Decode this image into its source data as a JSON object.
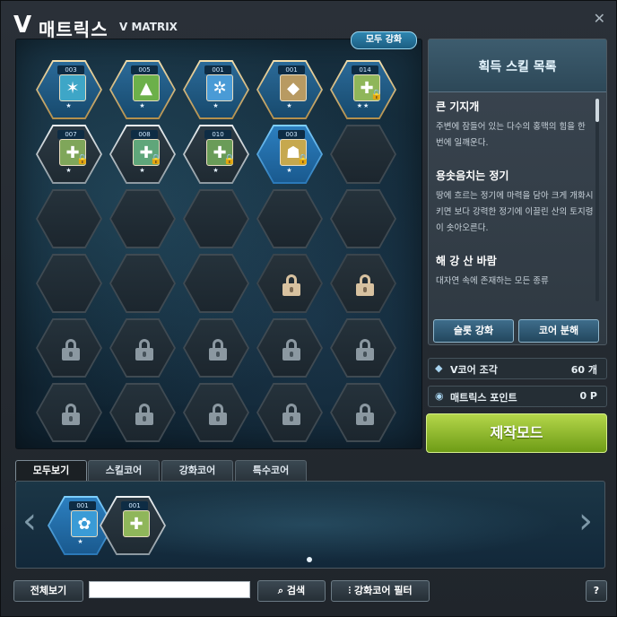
{
  "window": {
    "title_prefix": "V",
    "title": "매트릭스",
    "subtitle": "V MATRIX",
    "close": "✕"
  },
  "matrix": {
    "enhance_all_label": "모두 강화",
    "rows": [
      [
        {
          "state": "equipped",
          "frame": "gold",
          "num": "003",
          "icon": "✶",
          "color": "#3ea6c7",
          "stars": "★"
        },
        {
          "state": "equipped",
          "frame": "gold",
          "num": "005",
          "icon": "▲",
          "color": "#6cb04a",
          "stars": "★"
        },
        {
          "state": "equipped",
          "frame": "gold",
          "num": "001",
          "icon": "✲",
          "color": "#4a9bd6",
          "stars": "★"
        },
        {
          "state": "equipped",
          "frame": "gold",
          "num": "001",
          "icon": "◆",
          "color": "#b89a62",
          "stars": "★"
        },
        {
          "state": "equipped",
          "frame": "gold",
          "num": "014",
          "icon": "✚",
          "color": "#8fb65a",
          "stars": "★★",
          "lock": true
        }
      ],
      [
        {
          "state": "equipped",
          "frame": "silver",
          "num": "007",
          "icon": "✚",
          "color": "#7fa65a",
          "stars": "★",
          "lock": true
        },
        {
          "state": "equipped",
          "frame": "silver",
          "num": "008",
          "icon": "✚",
          "color": "#5fa67a",
          "stars": "★",
          "lock": true
        },
        {
          "state": "equipped",
          "frame": "silver",
          "num": "010",
          "icon": "✚",
          "color": "#6a9c58",
          "stars": "★",
          "lock": true
        },
        {
          "state": "equipped",
          "frame": "blue",
          "num": "003",
          "icon": "☗",
          "color": "#c6a84e",
          "stars": "★",
          "lock": true
        },
        {
          "state": "empty"
        }
      ],
      [
        {
          "state": "empty"
        },
        {
          "state": "empty"
        },
        {
          "state": "empty"
        },
        {
          "state": "empty"
        },
        {
          "state": "empty"
        }
      ],
      [
        {
          "state": "empty"
        },
        {
          "state": "empty"
        },
        {
          "state": "empty"
        },
        {
          "state": "locked-gold"
        },
        {
          "state": "locked-gold"
        }
      ],
      [
        {
          "state": "locked"
        },
        {
          "state": "locked"
        },
        {
          "state": "locked"
        },
        {
          "state": "locked"
        },
        {
          "state": "locked"
        }
      ],
      [
        {
          "state": "locked"
        },
        {
          "state": "locked"
        },
        {
          "state": "locked"
        },
        {
          "state": "locked"
        },
        {
          "state": "locked"
        }
      ]
    ]
  },
  "skills": {
    "header": "획득 스킬 목록",
    "list": [
      {
        "name": "큰 기지개",
        "desc": "주변에 잠들어 있는 다수의 홍맥의 힘을 한 번에 일깨운다."
      },
      {
        "name": "용솟음치는 정기",
        "desc": "땅에 흐르는 정기에 마력을 담아 크게 개화시키면 보다 강력한 정기에 이끌린 산의 토지령이 솟아오른다."
      },
      {
        "name": "해 강 산 바람",
        "desc": "대자연 속에 존재하는 모든 종류"
      }
    ],
    "slot_enhance_label": "슬롯 강화",
    "core_disassemble_label": "코어 분해"
  },
  "stats": {
    "vcore_label": "V코어 조각",
    "vcore_value": "60 개",
    "matrix_points_label": "매트릭스 포인트",
    "matrix_points_value": "0 P"
  },
  "craft_mode_label": "제작모드",
  "tabs": [
    "모두보기",
    "스킬코어",
    "강화코어",
    "특수코어"
  ],
  "inventory": {
    "items": [
      {
        "num": "001",
        "icon": "✿",
        "color": "#3a9bd6",
        "frame": "blue",
        "stars": "★"
      },
      {
        "num": "001",
        "icon": "✚",
        "color": "#8fb65a",
        "frame": "silver",
        "stars": ""
      }
    ],
    "prev_arrow": "‹",
    "next_arrow": "›"
  },
  "bottom": {
    "view_all_label": "전체보기",
    "search_value": "",
    "search_label": "검색",
    "filter_label": "강화코어 필터",
    "help_label": "?"
  },
  "colors": {
    "craft_button": "#8ab828",
    "panel_bg": "#143042",
    "accent_blue": "#2f86b0"
  }
}
